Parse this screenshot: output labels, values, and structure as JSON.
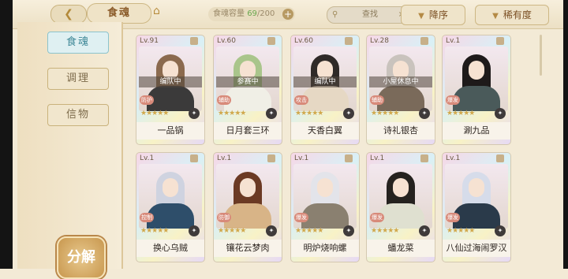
{
  "header": {
    "back_icon": "double-chevron-left",
    "title": "食魂",
    "home_icon": "house",
    "capacity": {
      "label": "食魂容量",
      "current": "69",
      "max": "/200",
      "plus": "+"
    },
    "search": {
      "icon": "magnifier",
      "placeholder": "查找",
      "clear": "×"
    },
    "sort_order": {
      "arrow": "▼",
      "label": "降序"
    },
    "sort_rarity": {
      "arrow": "▼",
      "label": "稀有度"
    }
  },
  "sidebar": {
    "tabs": [
      {
        "label": "食魂",
        "active": true
      },
      {
        "label": "调理",
        "active": false
      },
      {
        "label": "信物",
        "active": false
      }
    ],
    "decompose": "分解"
  },
  "cards": [
    {
      "level": "Lv.91",
      "status": "编队中",
      "type": "防护",
      "stars": "★★★★★",
      "name": "一品锅",
      "hair": "#8b6a4e",
      "robe": "#3b3a3a"
    },
    {
      "level": "Lv.60",
      "status": "参赛中",
      "type": "辅助",
      "stars": "★★★★★",
      "name": "日月套三环",
      "hair": "#a9c58b",
      "robe": "#f0efe6"
    },
    {
      "level": "Lv.60",
      "status": "编队中",
      "type": "攻击",
      "stars": "★★★★★",
      "name": "天香白翼",
      "hair": "#2f2a28",
      "robe": "#e6d8c4"
    },
    {
      "level": "Lv.28",
      "status": "小屋休息中",
      "type": "辅助",
      "stars": "★★★★★",
      "name": "诗礼银杏",
      "hair": "#c9c3bd",
      "robe": "#7a6a5a"
    },
    {
      "level": "Lv.1",
      "status": "",
      "type": "爆发",
      "stars": "★★★★★",
      "name": "涮九品",
      "hair": "#1e1a1a",
      "robe": "#4a5a5a"
    },
    {
      "level": "Lv.1",
      "status": "",
      "type": "控制",
      "stars": "★★★★★",
      "name": "换心乌贼",
      "hair": "#cfd3e0",
      "robe": "#2e4e6a"
    },
    {
      "level": "Lv.1",
      "status": "",
      "type": "防御",
      "stars": "★★★★★",
      "name": "镶花云梦肉",
      "hair": "#6b3a24",
      "robe": "#d8b487"
    },
    {
      "level": "Lv.1",
      "status": "",
      "type": "爆发",
      "stars": "★★★★★",
      "name": "明炉烧响螺",
      "hair": "#e3e4ea",
      "robe": "#8a8070"
    },
    {
      "level": "Lv.1",
      "status": "",
      "type": "爆发",
      "stars": "★★★★★",
      "name": "蟠龙菜",
      "hair": "#25221f",
      "robe": "#dfe0d0"
    },
    {
      "level": "Lv.1",
      "status": "",
      "type": "爆发",
      "stars": "★★★★★",
      "name": "八仙过海闹罗汉",
      "hair": "#d6dcea",
      "robe": "#2a3a4a"
    }
  ]
}
